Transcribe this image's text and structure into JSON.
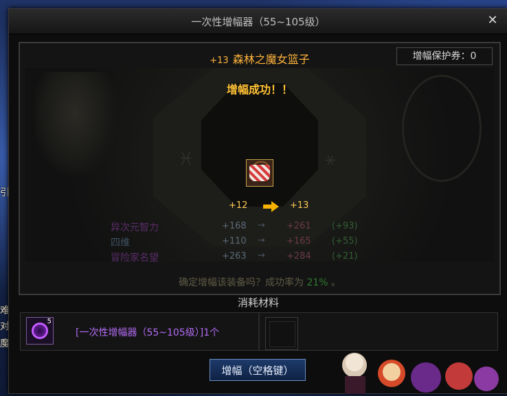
{
  "window": {
    "title": "一次性增幅器（55~105级）"
  },
  "item": {
    "level_prefix": "+13",
    "name": "森林之魔女篮子",
    "icon": "witch-basket-icon"
  },
  "protection_ticket": "增幅保护券：0",
  "result": {
    "message": "增幅成功！！",
    "from_level": "+12",
    "to_level": "+13"
  },
  "stats": [
    {
      "name": "异次元智力",
      "old": "+168",
      "arrow": "→",
      "new": "+261",
      "diff": "(+93)",
      "name_color": "#5b2d6a"
    },
    {
      "name": "四维",
      "old": "+110",
      "arrow": "→",
      "new": "+165",
      "diff": "(+55)",
      "name_color": "#3e5363"
    },
    {
      "name": "冒险家名望",
      "old": "+263",
      "arrow": "→",
      "new": "+284",
      "diff": "(+21)",
      "name_color": "#5b2d6a"
    }
  ],
  "confirm": {
    "prefix": "确定增幅该装备吗？成功率为",
    "rate": "21%",
    "suffix": "。"
  },
  "materials": {
    "header": "消耗材料",
    "item_label": "[一次性增幅器（55~105级）]1个",
    "slot_count": "5",
    "icon": "amplifier-orb-icon"
  },
  "button": {
    "label": "增幅（空格键）"
  },
  "background_text": [
    "引",
    "难",
    "对",
    "魔"
  ],
  "colors": {
    "accent": "#ffb43c",
    "success": "#ffc234",
    "material": "#b36cf5"
  }
}
